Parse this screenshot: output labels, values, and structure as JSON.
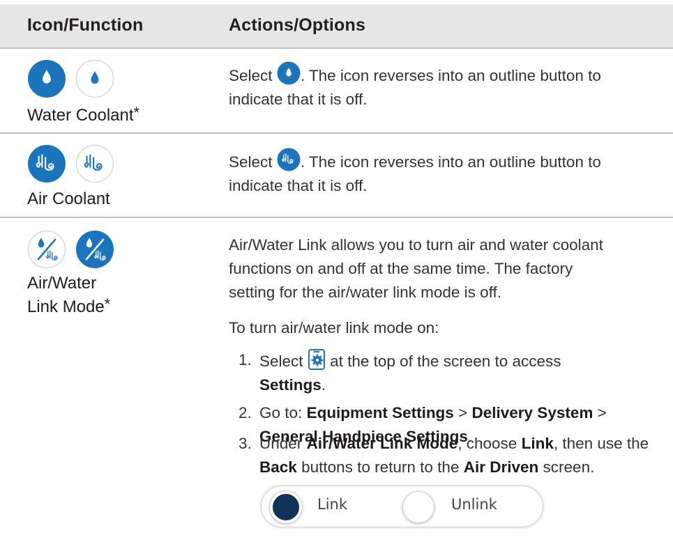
{
  "header": {
    "col1": "Icon/Function",
    "col2": "Actions/Options"
  },
  "rows": [
    {
      "label": "Water Coolant",
      "asterisk": "*",
      "icons": [
        "water-drop-filled-icon",
        "water-drop-outline-icon"
      ],
      "text_before": "Select",
      "text_after": ". The icon reverses into an outline button to indicate that it is off."
    },
    {
      "label": "Air Coolant",
      "icons": [
        "air-swirl-filled-icon",
        "air-swirl-outline-icon"
      ],
      "text_before": "Select",
      "text_after": ". The icon reverses into an outline button to indicate that it is off."
    },
    {
      "label_line1": "Air/Water",
      "label_line2": "Link Mode",
      "asterisk": "*",
      "icons": [
        "air-water-link-outline-icon",
        "air-water-link-filled-icon"
      ],
      "intro": "Air/Water Link allows you to turn air and water coolant functions on and off at the same time. The factory setting for the air/water link mode is off.",
      "steps_intro": "To turn air/water link mode on:",
      "steps": [
        {
          "num": "1.",
          "text_before": "Select",
          "icon": "settings-tablet-icon",
          "text_after": "at the top of the screen to access",
          "bold_end": "Settings",
          "period": "."
        },
        {
          "num": "2.",
          "go_to": "Go to:",
          "path1": "Equipment Settings",
          "sep1": ">",
          "path2": "Delivery System",
          "sep2": ">",
          "path3": "General Handpiece Settings",
          "period": "."
        },
        {
          "num": "3.",
          "under": "Under",
          "mode": "Air/Water Link Mode",
          "choose": ", choose",
          "link": "Link",
          "then": ", then use the",
          "back": "Back",
          "buttons": "buttons to return to the",
          "screen_name": "Air Driven",
          "screen": "screen."
        }
      ],
      "toggle": {
        "selected": "Link",
        "options": [
          "Link",
          "Unlink"
        ]
      }
    }
  ],
  "colors": {
    "accent_blue": "#1b75bc",
    "toggle_dark": "#0f3457",
    "header_band": "#e6e6e6"
  }
}
